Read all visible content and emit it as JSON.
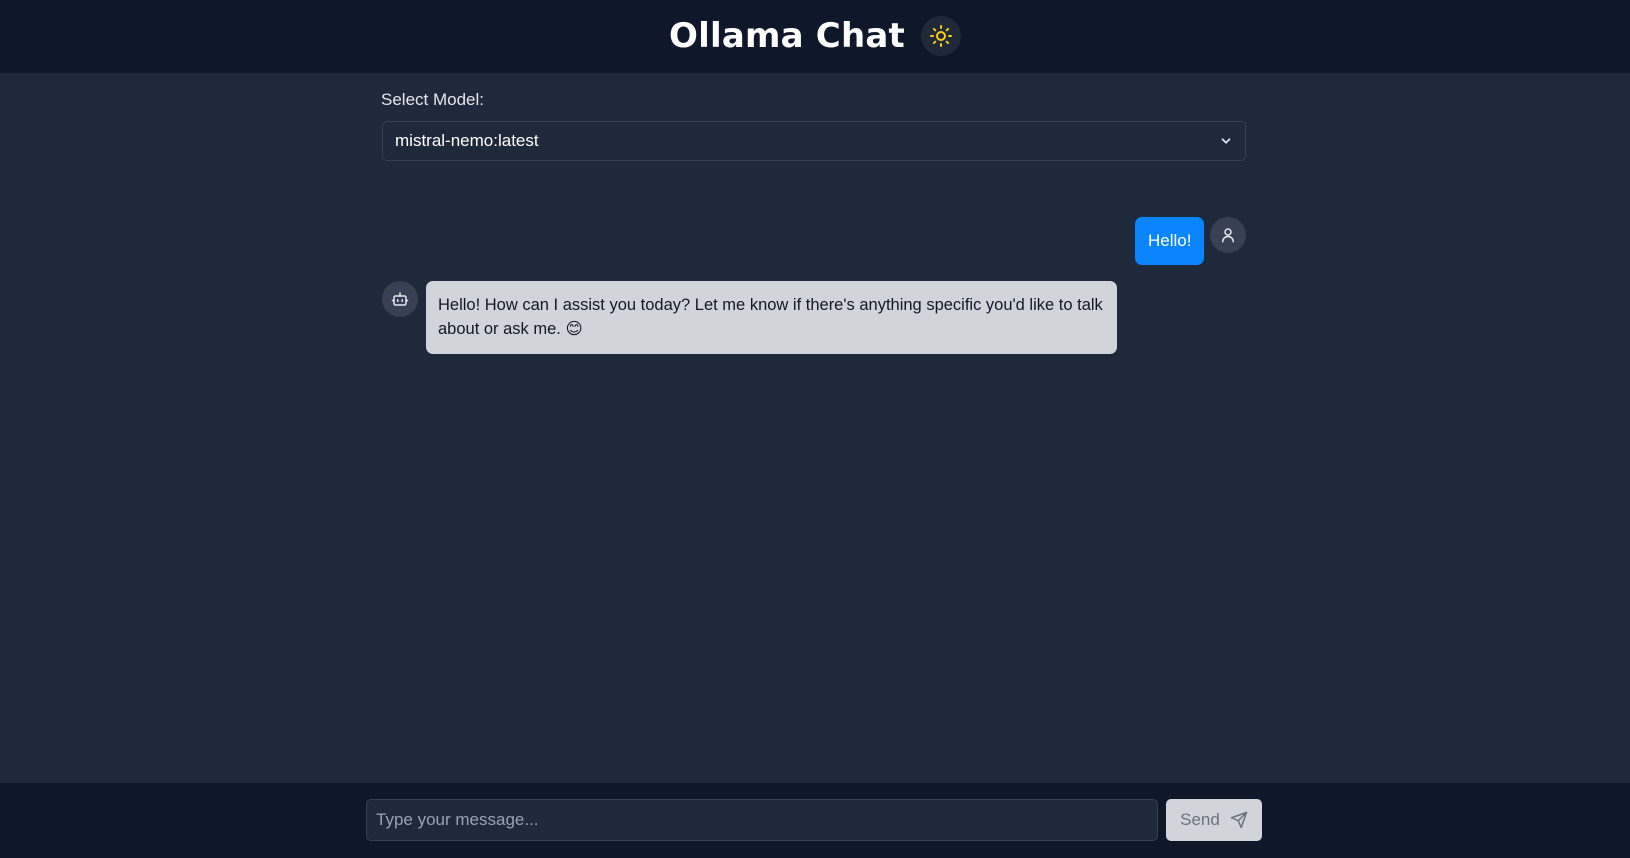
{
  "header": {
    "title": "Ollama Chat",
    "theme_toggle_icon": "sun-icon"
  },
  "model_selector": {
    "label": "Select Model:",
    "selected": "mistral-nemo:latest"
  },
  "messages": [
    {
      "role": "user",
      "avatar_icon": "user-icon",
      "text": "Hello!"
    },
    {
      "role": "assistant",
      "avatar_icon": "bot-icon",
      "text": "Hello! How can I assist you today? Let me know if there's anything specific you'd like to talk about or ask me.",
      "emoji": "😊"
    }
  ],
  "composer": {
    "placeholder": "Type your message...",
    "value": "",
    "send_label": "Send",
    "send_icon": "send-icon"
  },
  "colors": {
    "header_bg": "#0f172a",
    "page_bg": "#1e293b",
    "user_bubble": "#0a84ff",
    "bot_bubble": "#d1d5db",
    "sun": "#facc15"
  }
}
